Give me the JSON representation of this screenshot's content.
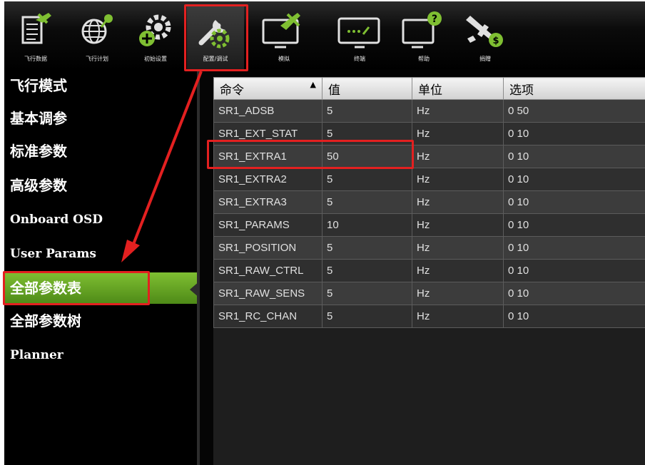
{
  "toolbar": {
    "buttons": [
      {
        "label": "飞行数据",
        "icon": "flight-data-icon"
      },
      {
        "label": "飞行计划",
        "icon": "flight-plan-icon"
      },
      {
        "label": "初始设置",
        "icon": "initial-setup-icon"
      },
      {
        "label": "配置/调试",
        "icon": "config-tuning-icon"
      },
      {
        "label": "模拟",
        "icon": "simulation-icon"
      },
      {
        "label": "终端",
        "icon": "terminal-icon"
      },
      {
        "label": "帮助",
        "icon": "help-icon"
      },
      {
        "label": "捐赠",
        "icon": "donate-icon"
      }
    ]
  },
  "menu": {
    "items": [
      {
        "label": "飞行模式"
      },
      {
        "label": "基本调参"
      },
      {
        "label": "标准参数"
      },
      {
        "label": "高级参数"
      },
      {
        "label": "Onboard OSD"
      },
      {
        "label": "User Params"
      },
      {
        "label": "全部参数表"
      },
      {
        "label": "全部参数树"
      },
      {
        "label": "Planner"
      }
    ],
    "active_index": 6
  },
  "table": {
    "headers": [
      "命令",
      "值",
      "单位",
      "选项"
    ],
    "sort_indicator": "▲",
    "rows": [
      [
        "SR1_ADSB",
        "5",
        "Hz",
        "0 50"
      ],
      [
        "SR1_EXT_STAT",
        "5",
        "Hz",
        "0 10"
      ],
      [
        "SR1_EXTRA1",
        "50",
        "Hz",
        "0 10"
      ],
      [
        "SR1_EXTRA2",
        "5",
        "Hz",
        "0 10"
      ],
      [
        "SR1_EXTRA3",
        "5",
        "Hz",
        "0 10"
      ],
      [
        "SR1_PARAMS",
        "10",
        "Hz",
        "0 10"
      ],
      [
        "SR1_POSITION",
        "5",
        "Hz",
        "0 10"
      ],
      [
        "SR1_RAW_CTRL",
        "5",
        "Hz",
        "0 10"
      ],
      [
        "SR1_RAW_SENS",
        "5",
        "Hz",
        "0 10"
      ],
      [
        "SR1_RC_CHAN",
        "5",
        "Hz",
        "0 10"
      ]
    ]
  },
  "colors": {
    "accent_green": "#7fbf32",
    "annotation_red": "#e32020",
    "background": "#000000"
  }
}
